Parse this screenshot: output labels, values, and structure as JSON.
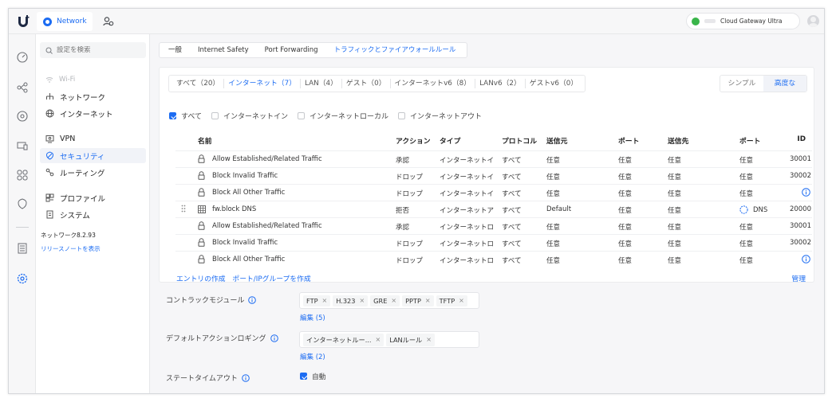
{
  "topbar": {
    "app_label": "Network",
    "gateway_name": "Cloud Gateway Ultra"
  },
  "sidebar": {
    "search_placeholder": "設定を検索",
    "items": [
      {
        "label": "Wi-Fi",
        "icon": "wifi-icon",
        "state": "disabled"
      },
      {
        "label": "ネットワーク",
        "icon": "network-icon"
      },
      {
        "label": "インターネット",
        "icon": "globe-icon"
      },
      {
        "label": "VPN",
        "icon": "vpn-icon"
      },
      {
        "label": "セキュリティ",
        "icon": "shield-icon",
        "state": "active"
      },
      {
        "label": "ルーティング",
        "icon": "routing-icon"
      },
      {
        "label": "プロファイル",
        "icon": "profile-icon"
      },
      {
        "label": "システム",
        "icon": "system-icon"
      }
    ],
    "version": "ネットワーク8.2.93",
    "release_notes": "リリースノートを表示"
  },
  "tabs": [
    "一般",
    "Internet Safety",
    "Port Forwarding",
    "トラフィックとファイアウォールルール"
  ],
  "active_tab": 3,
  "filters": [
    "すべて（20）",
    "インターネット（7）",
    "LAN（4）",
    "ゲスト（0）",
    "インターネットv6（8）",
    "LANv6（2）",
    "ゲストv6（0）"
  ],
  "active_filter": 1,
  "view_mode": {
    "simple": "シンプル",
    "advanced": "高度な",
    "selected": "advanced"
  },
  "checkboxes": [
    {
      "label": "すべて",
      "checked": true
    },
    {
      "label": "インターネットイン",
      "checked": false
    },
    {
      "label": "インターネットローカル",
      "checked": false
    },
    {
      "label": "インターネットアウト",
      "checked": false
    }
  ],
  "table": {
    "columns": [
      "名前",
      "アクション",
      "タイプ",
      "プロトコル",
      "送信元",
      "ポート",
      "送信先",
      "ポート",
      "ID"
    ],
    "rows": [
      {
        "name": "Allow Established/Related Traffic",
        "action": "承認",
        "type": "インターネットイ",
        "protocol": "すべて",
        "source": "任意",
        "sport": "任意",
        "dest": "任意",
        "dport": "任意",
        "id": "30001",
        "icon": "lock-icon"
      },
      {
        "name": "Block Invalid Traffic",
        "action": "ドロップ",
        "type": "インターネットイ",
        "protocol": "すべて",
        "source": "任意",
        "sport": "任意",
        "dest": "任意",
        "dport": "任意",
        "id": "30002",
        "icon": "lock-icon"
      },
      {
        "name": "Block All Other Traffic",
        "action": "ドロップ",
        "type": "インターネットイ",
        "protocol": "すべて",
        "source": "任意",
        "sport": "任意",
        "dest": "任意",
        "dport": "任意",
        "id": "",
        "icon": "lock-icon",
        "info": true
      },
      {
        "name": "fw.block DNS",
        "action": "拒否",
        "type": "インターネットア",
        "protocol": "すべて",
        "source": "Default",
        "sport": "任意",
        "dest": "任意",
        "dport": "DNS",
        "id": "20000",
        "icon": "ip-group-icon",
        "draggable": true
      },
      {
        "name": "Allow Established/Related Traffic",
        "action": "承認",
        "type": "インターネットロ",
        "protocol": "すべて",
        "source": "任意",
        "sport": "任意",
        "dest": "任意",
        "dport": "任意",
        "id": "30001",
        "icon": "lock-icon"
      },
      {
        "name": "Block Invalid Traffic",
        "action": "ドロップ",
        "type": "インターネットロ",
        "protocol": "すべて",
        "source": "任意",
        "sport": "任意",
        "dest": "任意",
        "dport": "任意",
        "id": "30002",
        "icon": "lock-icon"
      },
      {
        "name": "Block All Other Traffic",
        "action": "ドロップ",
        "type": "インターネットロ",
        "protocol": "すべて",
        "source": "任意",
        "sport": "任意",
        "dest": "任意",
        "dport": "任意",
        "id": "",
        "icon": "lock-icon",
        "info": true
      }
    ]
  },
  "links": {
    "create_entry": "エントリの作成",
    "create_group": "ポート/IPグループを作成",
    "manage": "管理"
  },
  "settings": {
    "conntrack": {
      "label": "コントラックモジュール",
      "chips": [
        "FTP",
        "H.323",
        "GRE",
        "PPTP",
        "TFTP"
      ],
      "edit": "編集 (5)"
    },
    "default_logging": {
      "label": "デフォルトアクションロギング",
      "chips": [
        "インターネットルー...",
        "LANルール"
      ],
      "edit": "編集 (2)"
    },
    "state_timeout": {
      "label": "ステートタイムアウト",
      "auto_label": "自動",
      "checked": true
    }
  },
  "colors": {
    "accent": "#1c6cf2",
    "ok": "#39b54a"
  }
}
